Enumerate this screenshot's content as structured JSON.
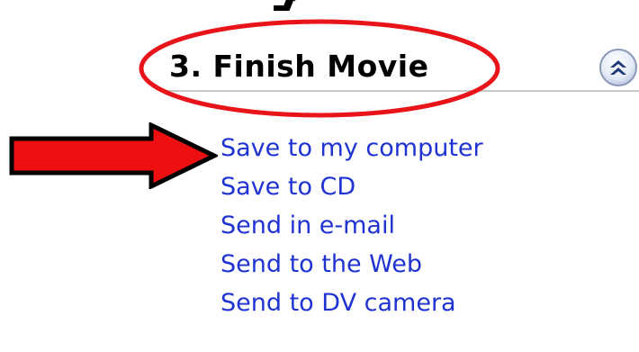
{
  "panel": {
    "section": {
      "title": "3. Finish Movie",
      "collapse_icon": "chevron-up-circle-icon"
    },
    "tasks": [
      {
        "label": "Save to my computer"
      },
      {
        "label": "Save to CD"
      },
      {
        "label": "Send in e-mail"
      },
      {
        "label": "Send to the Web"
      },
      {
        "label": "Send to DV camera"
      }
    ]
  },
  "annotations": {
    "ellipse_color": "#e8141a",
    "arrow_fill": "#ee0f10",
    "arrow_outline": "#000000"
  },
  "colors": {
    "link": "#1f33d2",
    "title": "#000000",
    "divider": "#c8c8c8"
  }
}
